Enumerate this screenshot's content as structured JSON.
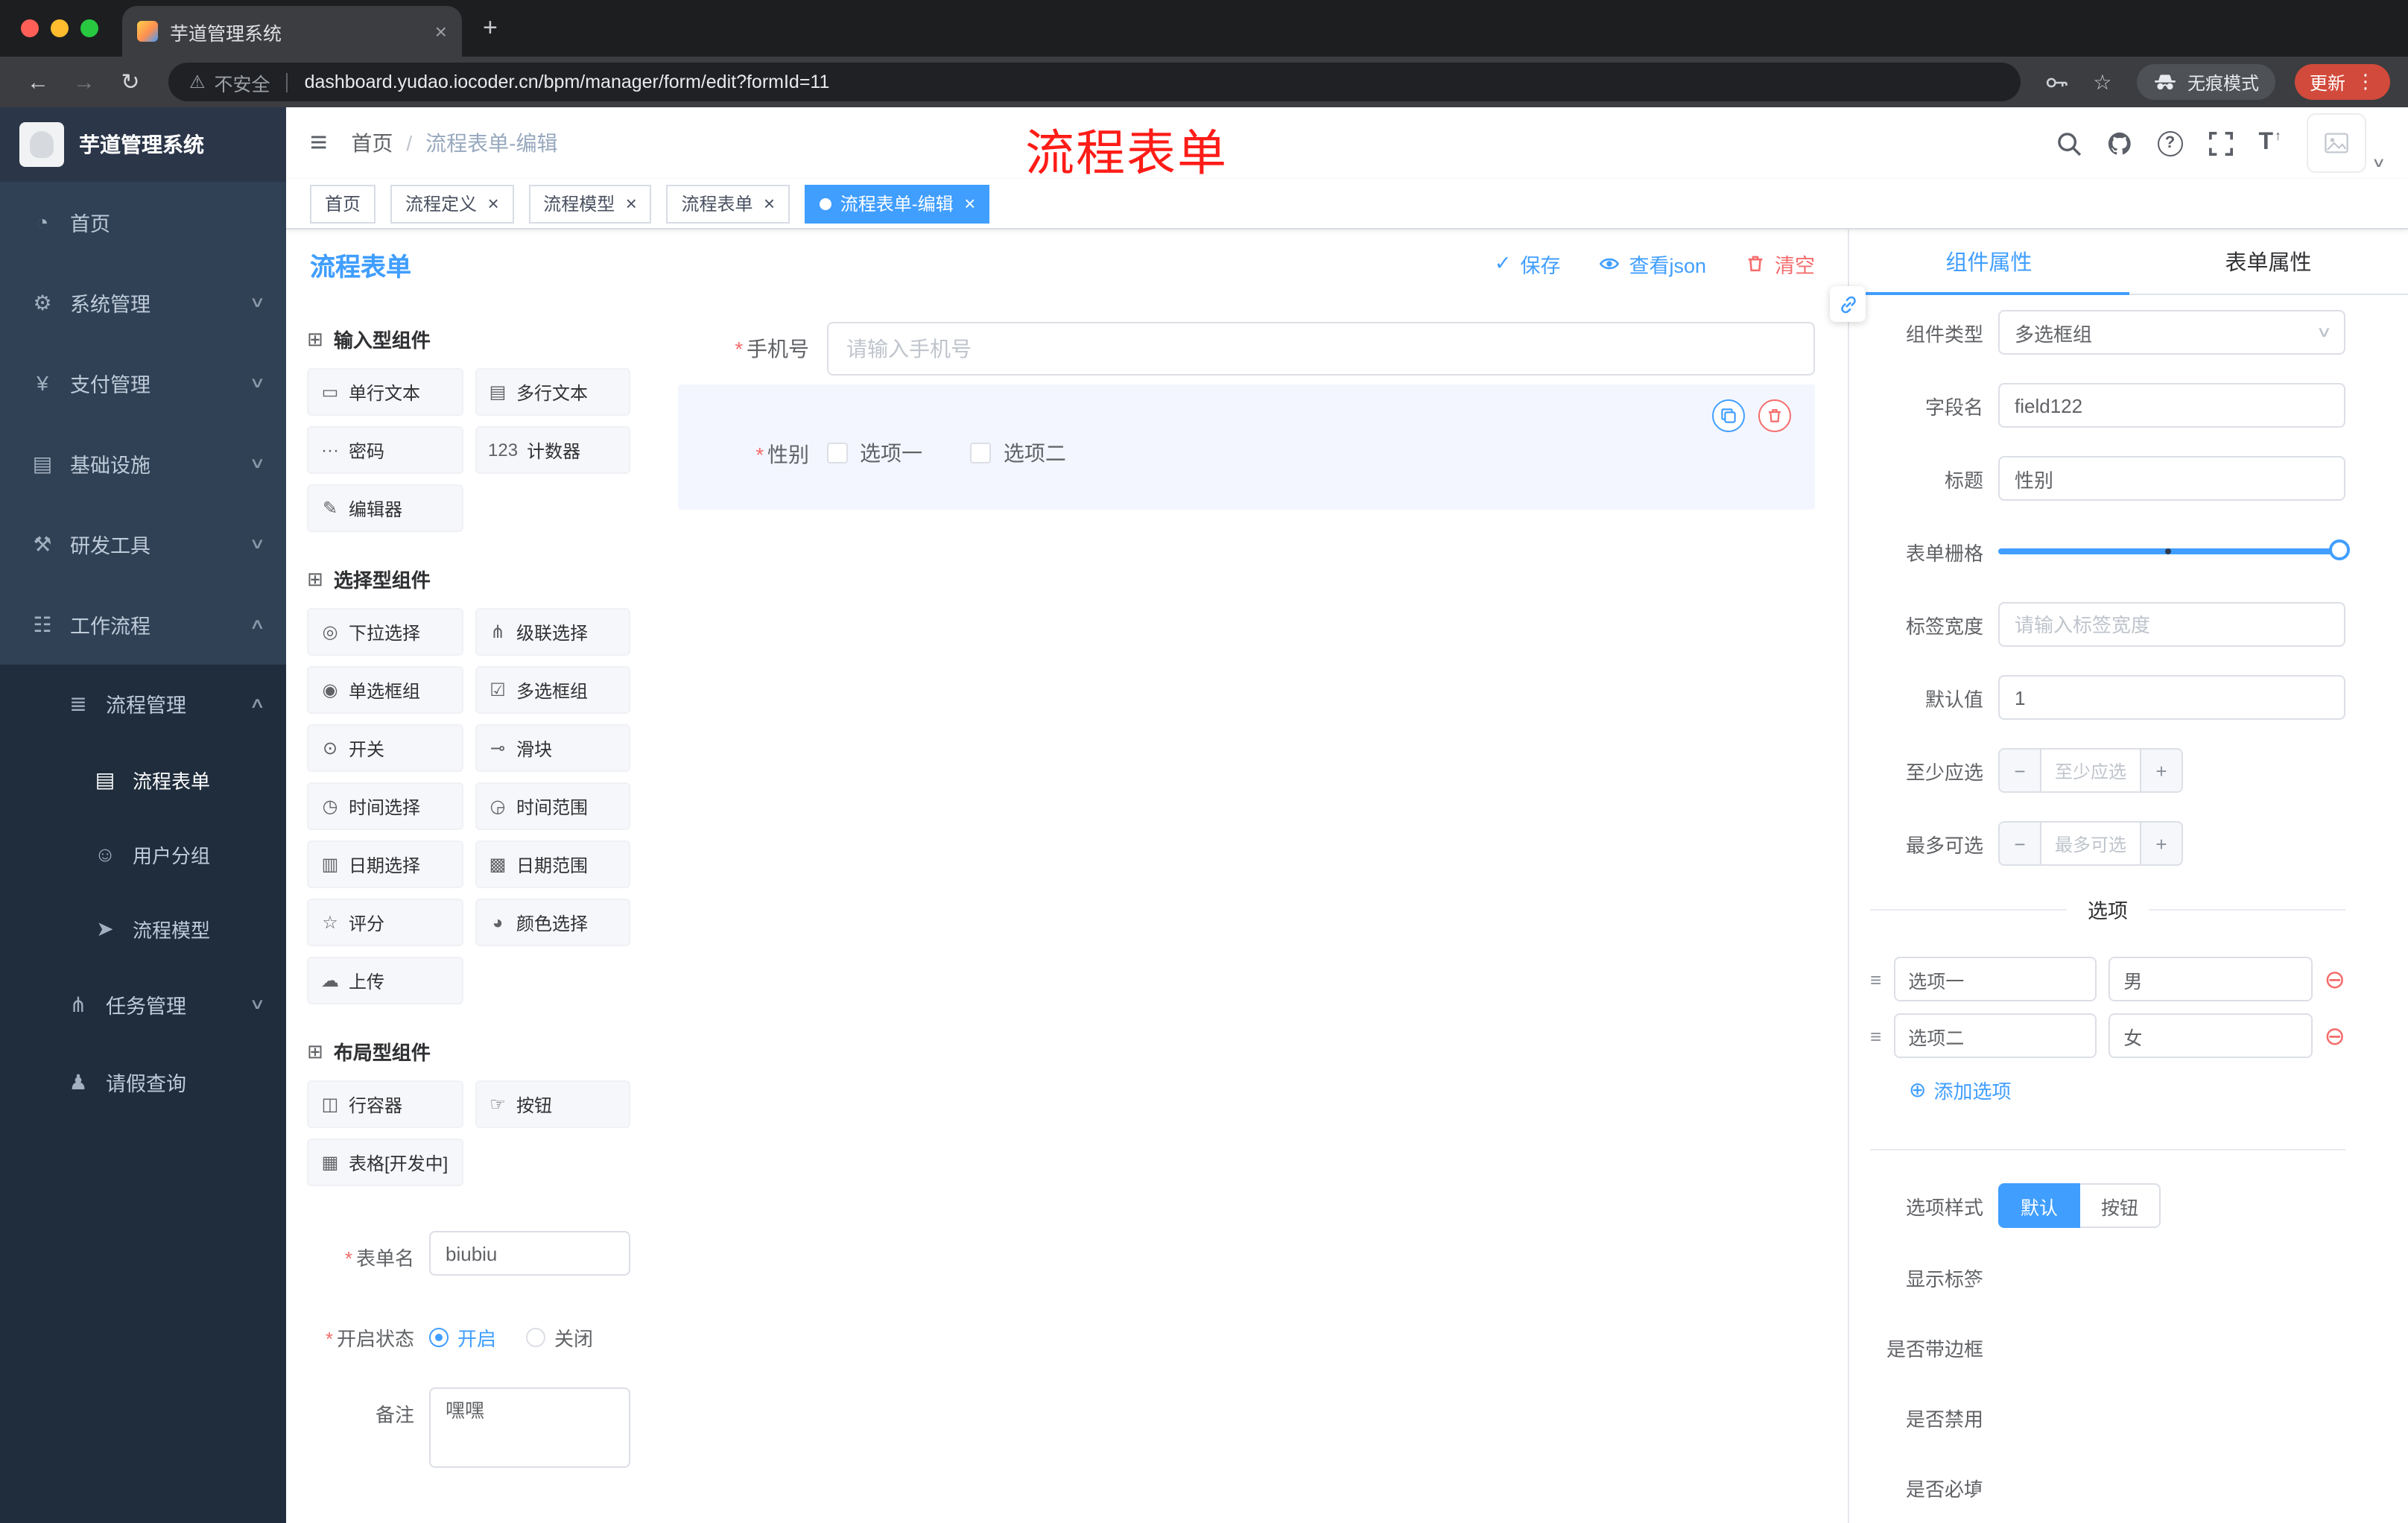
{
  "colors": {
    "accent": "#409EFF",
    "danger": "#F56C6C",
    "annotation_red": "#FE1C17",
    "sidebar_bg": "#304156",
    "sidebar_sub_bg": "#1F2D3D"
  },
  "glyphs": {
    "hamburger": "≡",
    "back": "←",
    "forward": "→",
    "reload": "↻",
    "warning": "⚠",
    "star": "☆",
    "close": "×",
    "new_tab": "+",
    "kebab": "⋮",
    "check": "✓",
    "plus_circle": "⊕",
    "minus_circle": "⊖",
    "drag_handle": "≡",
    "font_size": "T",
    "font_size_arrow": "↑",
    "caret_down": "∨",
    "help": "?"
  },
  "browser": {
    "tab": {
      "title": "芋道管理系统"
    },
    "address": {
      "warning": "不安全",
      "url": "dashboard.yudao.iocoder.cn/bpm/manager/form/edit?formId=11"
    },
    "incognito_label": "无痕模式",
    "update_label": "更新"
  },
  "annotation": {
    "text": "流程表单"
  },
  "sidebar": {
    "title": "芋道管理系统",
    "items": [
      {
        "icon": "dashboard-icon",
        "glyph": "◔",
        "label": "首页",
        "level": "1",
        "chev": ""
      },
      {
        "icon": "system-management-icon",
        "glyph": "⚙",
        "label": "系统管理",
        "level": "1",
        "chev": "∨"
      },
      {
        "icon": "payment-management-icon",
        "glyph": "¥",
        "label": "支付管理",
        "level": "1",
        "chev": "∨"
      },
      {
        "icon": "infrastructure-icon",
        "glyph": "▤",
        "label": "基础设施",
        "level": "1",
        "chev": "∨"
      },
      {
        "icon": "devtools-icon",
        "glyph": "⚒",
        "label": "研发工具",
        "level": "1",
        "chev": "∨"
      },
      {
        "icon": "workflow-icon",
        "glyph": "☷",
        "label": "工作流程",
        "level": "1",
        "chev": "∧",
        "open": true
      },
      {
        "icon": "process-management-icon",
        "glyph": "≣",
        "label": "流程管理",
        "level": "2",
        "chev": "∧",
        "open": true
      },
      {
        "icon": "process-form-icon",
        "glyph": "▤",
        "label": "流程表单",
        "level": "3",
        "chev": "",
        "active": true
      },
      {
        "icon": "user-group-icon",
        "glyph": "☺",
        "label": "用户分组",
        "level": "3",
        "chev": ""
      },
      {
        "icon": "process-model-icon",
        "glyph": "➤",
        "label": "流程模型",
        "level": "3",
        "chev": ""
      },
      {
        "icon": "task-management-icon",
        "glyph": "⋔",
        "label": "任务管理",
        "level": "2",
        "chev": "∨"
      },
      {
        "icon": "leave-query-icon",
        "glyph": "♟",
        "label": "请假查询",
        "level": "2",
        "chev": ""
      }
    ]
  },
  "navbar": {
    "breadcrumb": {
      "root": "首页",
      "sep": "/",
      "current": "流程表单-编辑"
    }
  },
  "tags": [
    {
      "label": "首页"
    },
    {
      "label": "流程定义",
      "closable": true
    },
    {
      "label": "流程模型",
      "closable": true
    },
    {
      "label": "流程表单",
      "closable": true
    },
    {
      "label": "流程表单-编辑",
      "closable": true,
      "active": true
    }
  ],
  "designer": {
    "title": "流程表单",
    "actions": {
      "save": "保存",
      "view_json": "查看json",
      "clear": "清空"
    },
    "sections": {
      "input": {
        "title": "输入型组件",
        "items": [
          {
            "icon": "single-line-text-icon",
            "glyph": "▭",
            "label": "单行文本"
          },
          {
            "icon": "multi-line-text-icon",
            "glyph": "▤",
            "label": "多行文本"
          },
          {
            "icon": "password-icon",
            "glyph": "···",
            "label": "密码"
          },
          {
            "icon": "counter-icon",
            "glyph": "123",
            "label": "计数器"
          },
          {
            "icon": "editor-icon",
            "glyph": "✎",
            "label": "编辑器"
          }
        ]
      },
      "select": {
        "title": "选择型组件",
        "items": [
          {
            "icon": "dropdown-select-icon",
            "glyph": "◎",
            "label": "下拉选择"
          },
          {
            "icon": "cascade-select-icon",
            "glyph": "⋔",
            "label": "级联选择"
          },
          {
            "icon": "radio-group-icon",
            "glyph": "◉",
            "label": "单选框组"
          },
          {
            "icon": "checkbox-group-icon",
            "glyph": "☑",
            "label": "多选框组"
          },
          {
            "icon": "switch-icon",
            "glyph": "⊙",
            "label": "开关"
          },
          {
            "icon": "slider-icon",
            "glyph": "⊸",
            "label": "滑块"
          },
          {
            "icon": "time-picker-icon",
            "glyph": "◷",
            "label": "时间选择"
          },
          {
            "icon": "time-range-icon",
            "glyph": "◶",
            "label": "时间范围"
          },
          {
            "icon": "date-picker-icon",
            "glyph": "▥",
            "label": "日期选择"
          },
          {
            "icon": "date-range-icon",
            "glyph": "▩",
            "label": "日期范围"
          },
          {
            "icon": "rating-icon",
            "glyph": "☆",
            "label": "评分"
          },
          {
            "icon": "color-picker-icon",
            "glyph": "◕",
            "label": "颜色选择"
          },
          {
            "icon": "upload-icon",
            "glyph": "☁",
            "label": "上传"
          }
        ]
      },
      "layout": {
        "title": "布局型组件",
        "items": [
          {
            "icon": "row-container-icon",
            "glyph": "◫",
            "label": "行容器"
          },
          {
            "icon": "button-icon",
            "glyph": "☞",
            "label": "按钮"
          },
          {
            "icon": "table-icon",
            "glyph": "▦",
            "label": "表格[开发中]"
          }
        ]
      }
    },
    "meta": {
      "name_label": "表单名",
      "name_value": "biubiu",
      "status_label": "开启状态",
      "status_on": "开启",
      "status_off": "关闭",
      "remark_label": "备注",
      "remark_value": "嘿嘿"
    },
    "canvas": {
      "phone_label": "手机号",
      "phone_placeholder": "请输入手机号",
      "gender_label": "性别",
      "gender_options": [
        "选项一",
        "选项二"
      ]
    }
  },
  "panel": {
    "tabs": {
      "component": "组件属性",
      "form": "表单属性"
    },
    "component_type_label": "组件类型",
    "component_type_value": "多选框组",
    "field_label": "字段名",
    "field_value": "field122",
    "title_label": "标题",
    "title_value": "性别",
    "grid_label": "表单栅格",
    "label_width_label": "标签宽度",
    "label_width_placeholder": "请输入标签宽度",
    "default_label": "默认值",
    "default_value": "1",
    "min_label": "至少应选",
    "min_placeholder": "至少应选",
    "max_label": "最多可选",
    "max_placeholder": "最多可选",
    "options_title": "选项",
    "options": [
      {
        "name": "选项一",
        "value": "男"
      },
      {
        "name": "选项二",
        "value": "女"
      }
    ],
    "add_option": "添加选项",
    "style_label": "选项样式",
    "style_default": "默认",
    "style_button": "按钮",
    "toggles": [
      {
        "label": "显示标签",
        "on": true
      },
      {
        "label": "是否带边框",
        "on": false
      },
      {
        "label": "是否禁用",
        "on": false
      },
      {
        "label": "是否必填",
        "on": true
      }
    ]
  }
}
